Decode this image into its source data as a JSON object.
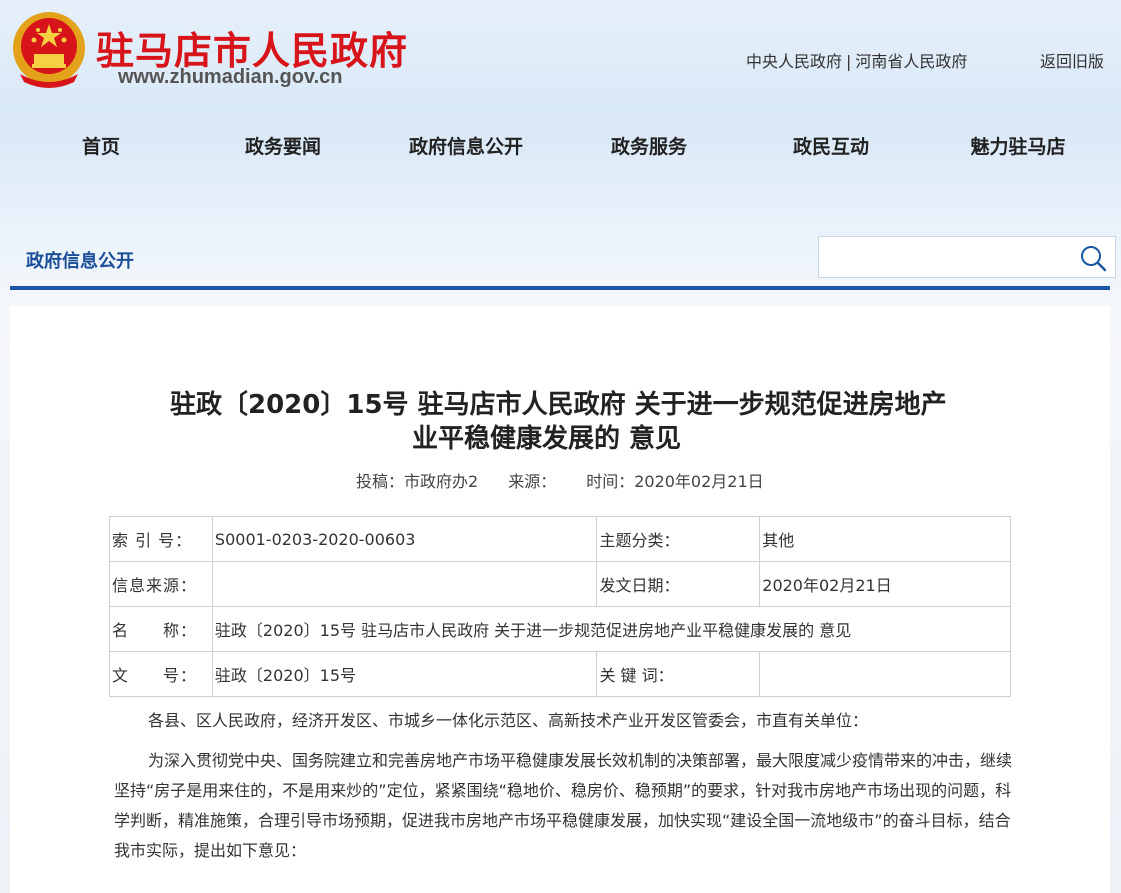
{
  "site": {
    "name": "驻马店市人民政府",
    "url": "www.zhumadian.gov.cn",
    "top_links": [
      "中央人民政府",
      "河南省人民政府"
    ],
    "top_links_sep": "|",
    "old_version": "返回旧版"
  },
  "nav": [
    "首页",
    "政务要闻",
    "政府信息公开",
    "政务服务",
    "政民互动",
    "魅力驻马店"
  ],
  "section_title": "政府信息公开",
  "search": {
    "placeholder": ""
  },
  "colors": {
    "brand_red": "#d7141a",
    "accent_blue": "#1a56a6"
  },
  "document": {
    "title_line1": "驻政〔2020〕15号 驻马店市人民政府 关于进一步规范促进房地产",
    "title_line2": "业平稳健康发展的 意见",
    "meta": {
      "author": "投稿：市政府办2",
      "source": "来源：",
      "date": "时间：2020年02月21日"
    },
    "info": {
      "index_label": "索 引 号：",
      "index_value": "S0001-0203-2020-00603",
      "category_label": "主题分类：",
      "category_value": "其他",
      "origin_label": "信息来源：",
      "origin_value": "",
      "issue_date_label": "发文日期：",
      "issue_date_value": "2020年02月21日",
      "name_label": "名　　称：",
      "name_value": "驻政〔2020〕15号 驻马店市人民政府 关于进一步规范促进房地产业平稳健康发展的 意见",
      "doc_no_label": "文　　号：",
      "doc_no_value": "驻政〔2020〕15号",
      "keywords_label": "关 键 词：",
      "keywords_value": ""
    },
    "addressee": "各县、区人民政府，经济开发区、市城乡一体化示范区、高新技术产业开发区管委会，市直有关单位：",
    "paragraph1": "为深入贯彻党中央、国务院建立和完善房地产市场平稳健康发展长效机制的决策部署，最大限度减少疫情带来的冲击，继续坚持“房子是用来住的，不是用来炒的”定位，紧紧围绕“稳地价、稳房价、稳预期”的要求，针对我市房地产市场出现的问题，科学判断，精准施策，合理引导市场预期，促进我市房地产市场平稳健康发展，加快实现“建设全国一流地级市”的奋斗目标，结合我市实际，提出如下意见："
  }
}
